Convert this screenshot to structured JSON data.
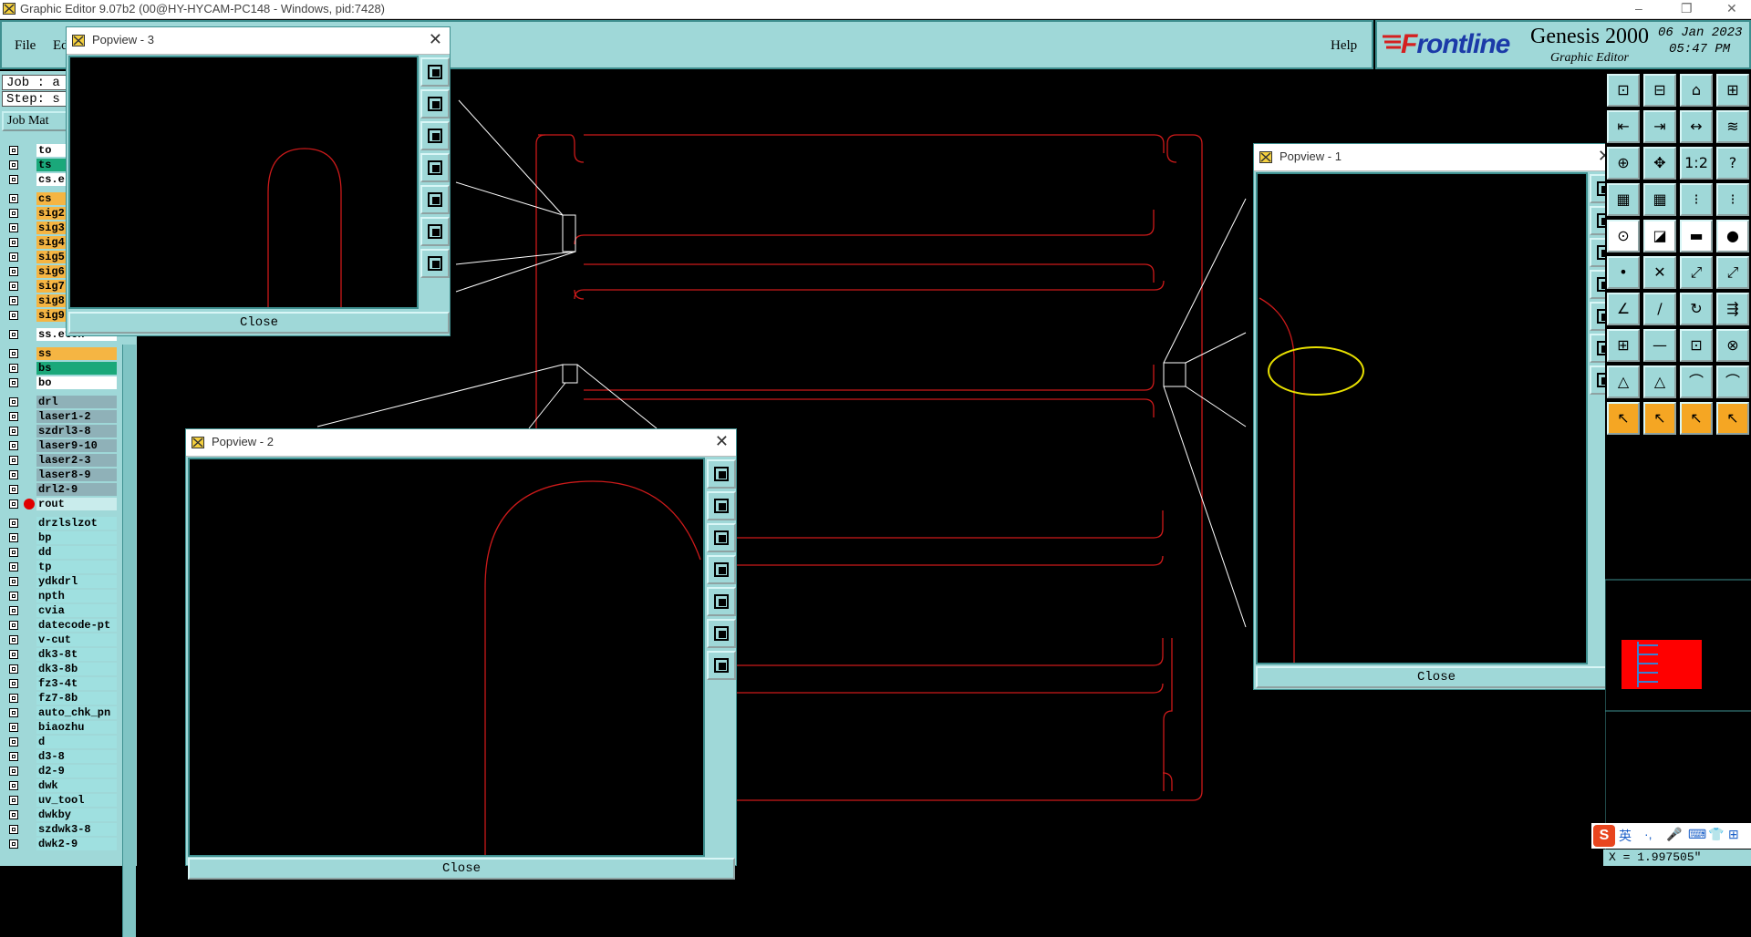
{
  "os_window": {
    "title": "Graphic Editor 9.07b2 (00@HY-HYCAM-PC148 - Windows, pid:7428)",
    "minimize": "–",
    "restore": "❐",
    "close": "✕"
  },
  "menubar": {
    "file": "File",
    "edit": "Ed",
    "help": "Help"
  },
  "brand": {
    "logo_f": "F",
    "logo_rest": "rontline",
    "product": "Genesis 2000",
    "subtitle": "Graphic Editor",
    "date": "06 Jan 2023",
    "time": "05:47 PM"
  },
  "left_panel": {
    "job": "Job : a",
    "step": "Step: s",
    "job_matrix": "Job Mat",
    "layers": [
      {
        "name": "to",
        "color": "white"
      },
      {
        "name": "ts",
        "color": "green"
      },
      {
        "name": "cs.e",
        "color": "white"
      },
      {
        "name": "cs",
        "color": "orange"
      },
      {
        "name": "sig2",
        "color": "orange"
      },
      {
        "name": "sig3",
        "color": "orange"
      },
      {
        "name": "sig4",
        "color": "orange"
      },
      {
        "name": "sig5",
        "color": "orange"
      },
      {
        "name": "sig6",
        "color": "orange"
      },
      {
        "name": "sig7",
        "color": "orange"
      },
      {
        "name": "sig8",
        "color": "orange"
      },
      {
        "name": "sig9",
        "color": "orange"
      },
      {
        "name": "ss.etch",
        "color": "white"
      },
      {
        "name": "ss",
        "color": "orange"
      },
      {
        "name": "bs",
        "color": "green"
      },
      {
        "name": "bo",
        "color": "white"
      },
      {
        "name": "drl",
        "color": "gray"
      },
      {
        "name": "laser1-2",
        "color": "gray"
      },
      {
        "name": "szdrl3-8",
        "color": "gray"
      },
      {
        "name": "laser9-10",
        "color": "gray"
      },
      {
        "name": "laser2-3",
        "color": "gray"
      },
      {
        "name": "laser8-9",
        "color": "gray"
      },
      {
        "name": "drl2-9",
        "color": "gray"
      },
      {
        "name": "rout",
        "color": "light",
        "active": true
      },
      {
        "name": "drzlslzot",
        "color": "cyan"
      },
      {
        "name": "bp",
        "color": "cyan"
      },
      {
        "name": "dd",
        "color": "cyan"
      },
      {
        "name": "tp",
        "color": "cyan"
      },
      {
        "name": "ydkdrl",
        "color": "cyan"
      },
      {
        "name": "npth",
        "color": "cyan"
      },
      {
        "name": "cvia",
        "color": "cyan"
      },
      {
        "name": "datecode-pt",
        "color": "cyan"
      },
      {
        "name": "v-cut",
        "color": "cyan"
      },
      {
        "name": "dk3-8t",
        "color": "cyan"
      },
      {
        "name": "dk3-8b",
        "color": "cyan"
      },
      {
        "name": "fz3-4t",
        "color": "cyan"
      },
      {
        "name": "fz7-8b",
        "color": "cyan"
      },
      {
        "name": "auto_chk_pn",
        "color": "cyan"
      },
      {
        "name": "biaozhu",
        "color": "cyan"
      },
      {
        "name": "d",
        "color": "cyan"
      },
      {
        "name": "d3-8",
        "color": "cyan"
      },
      {
        "name": "d2-9",
        "color": "cyan"
      },
      {
        "name": "dwk",
        "color": "cyan"
      },
      {
        "name": "uv_tool",
        "color": "cyan"
      },
      {
        "name": "dwkby",
        "color": "cyan"
      },
      {
        "name": "szdwk3-8",
        "color": "cyan"
      },
      {
        "name": "dwk2-9",
        "color": "cyan"
      }
    ],
    "colors": {
      "white": "#ffffff",
      "green": "#1aa87a",
      "orange": "#f5b543",
      "gray": "#8fb1b8",
      "cyan": "#9fe0e0",
      "light": "#c9ecec"
    }
  },
  "popviews": [
    {
      "title": "Popview - 3",
      "close_label": "Close",
      "close_x": "✕"
    },
    {
      "title": "Popview - 2",
      "close_label": "Close",
      "close_x": "✕"
    },
    {
      "title": "Popview - 1",
      "close_label": "Close",
      "close_x": "✕"
    }
  ],
  "popview_tools": [
    "zoom-window",
    "zoom-in",
    "zoom-out",
    "pan-left",
    "pan-right",
    "fit-all",
    "center"
  ],
  "right_toolbar": {
    "rows": [
      [
        "⊡",
        "⊟",
        "⌂",
        "⊞"
      ],
      [
        "⇤",
        "⇥",
        "↔",
        "≋"
      ],
      [
        "⊕",
        "✥",
        "1:2",
        "?"
      ],
      [
        "▦",
        "▦",
        "⁝",
        "⁝"
      ],
      [
        "⊙",
        "◪",
        "▬",
        "●"
      ],
      [
        "•",
        "✕",
        "⤢",
        "⤢"
      ],
      [
        "∠",
        "∕",
        "↻",
        "⇶"
      ],
      [
        "⊞",
        "—",
        "⊡",
        "⊗"
      ],
      [
        "△",
        "△",
        "⌒",
        "⌒"
      ],
      [
        "↖",
        "↖",
        "↖",
        "↖"
      ]
    ]
  },
  "status": {
    "x_readout": "X = 1.997505\""
  },
  "ime": {
    "logo": "S",
    "lang": "英",
    "items": [
      "·,",
      "🎤",
      "⌨",
      "👕",
      "⊞"
    ]
  },
  "theme": {
    "panel": "#9fd8d8",
    "border": "#3e8f8f",
    "rout_line": "#cc1a1a",
    "highlight": "#e8e000",
    "red_block": "#ff0000"
  }
}
